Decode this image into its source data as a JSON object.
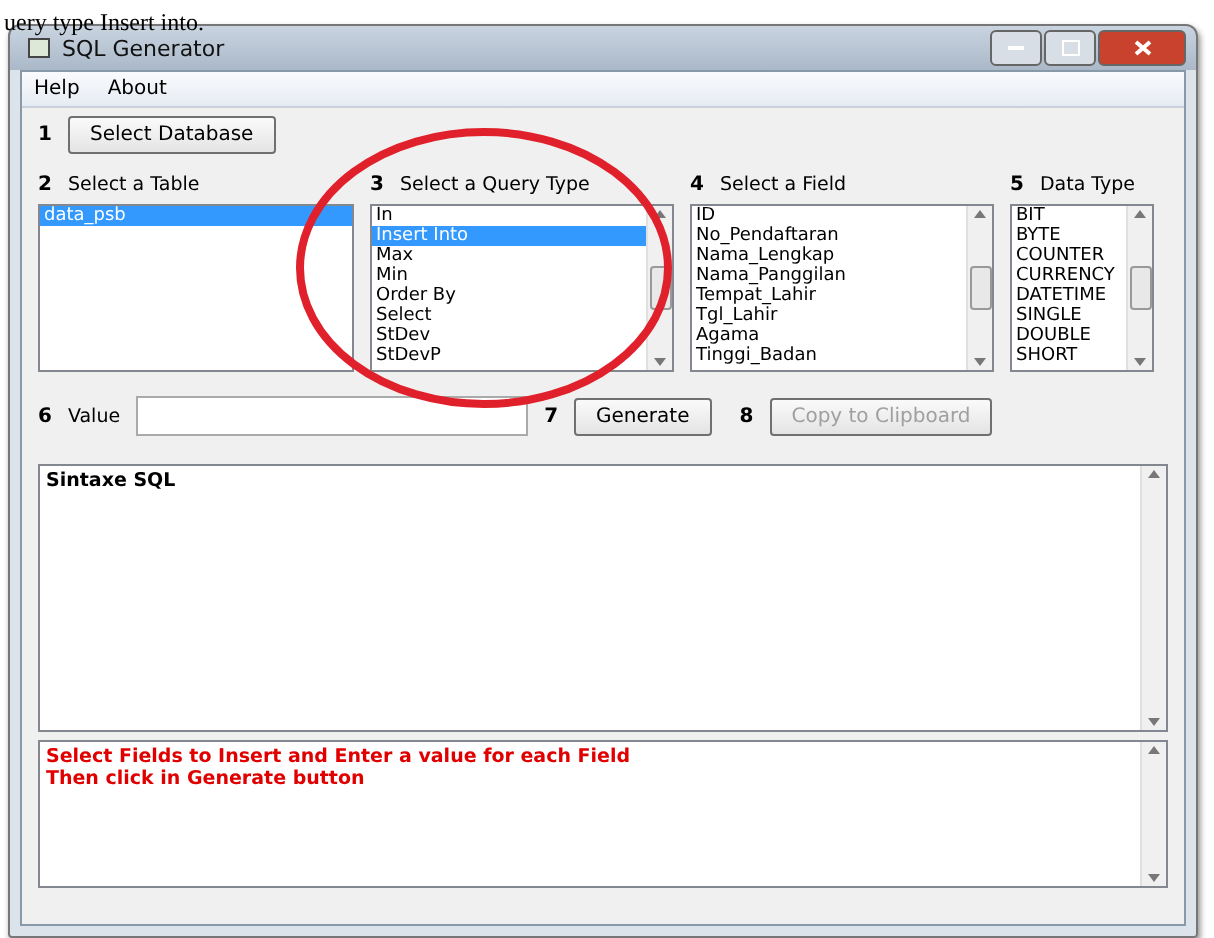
{
  "caption_top": "uery type Insert into.",
  "window": {
    "title": "SQL Generator"
  },
  "menu": [
    "Help",
    "About"
  ],
  "steps": [
    {
      "number": "1",
      "button": "Select Database"
    }
  ],
  "sections": [
    {
      "number": "2",
      "label": "Select a Table",
      "items": [
        {
          "label": "data_psb",
          "selected": true
        }
      ],
      "scrollbar": false
    },
    {
      "number": "3",
      "label": "Select a Query Type",
      "items": [
        {
          "label": "In",
          "selected": false
        },
        {
          "label": "Insert Into",
          "selected": true
        },
        {
          "label": "Max",
          "selected": false
        },
        {
          "label": "Min",
          "selected": false
        },
        {
          "label": "Order By",
          "selected": false
        },
        {
          "label": "Select",
          "selected": false
        },
        {
          "label": "StDev",
          "selected": false
        },
        {
          "label": "StDevP",
          "selected": false
        }
      ],
      "scrollbar": true
    },
    {
      "number": "4",
      "label": "Select a Field",
      "items": [
        {
          "label": "ID",
          "selected": false
        },
        {
          "label": "No_Pendaftaran",
          "selected": false
        },
        {
          "label": "Nama_Lengkap",
          "selected": false
        },
        {
          "label": "Nama_Panggilan",
          "selected": false
        },
        {
          "label": "Tempat_Lahir",
          "selected": false
        },
        {
          "label": "Tgl_Lahir",
          "selected": false
        },
        {
          "label": "Agama",
          "selected": false
        },
        {
          "label": "Tinggi_Badan",
          "selected": false
        }
      ],
      "scrollbar": true
    },
    {
      "number": "5",
      "label": "Data Type",
      "items": [
        {
          "label": "BIT",
          "selected": false
        },
        {
          "label": "BYTE",
          "selected": false
        },
        {
          "label": "COUNTER",
          "selected": false
        },
        {
          "label": "CURRENCY",
          "selected": false
        },
        {
          "label": "DATETIME",
          "selected": false
        },
        {
          "label": "SINGLE",
          "selected": false
        },
        {
          "label": "DOUBLE",
          "selected": false
        },
        {
          "label": "SHORT",
          "selected": false
        }
      ],
      "scrollbar": true
    }
  ],
  "value_row": {
    "number": "6",
    "label": "Value",
    "generate_number": "7",
    "generate": "Generate",
    "generate_disabled": false,
    "copy_number": "8",
    "copy": "Copy to Clipboard",
    "copy_disabled": true
  },
  "syntax": "Sintaxe SQL",
  "message": [
    "Select Fields to Insert and Enter a value for each Field",
    "Then click in Generate button"
  ],
  "annotation": {
    "kind": "ellipse",
    "color": "#e0202a"
  }
}
